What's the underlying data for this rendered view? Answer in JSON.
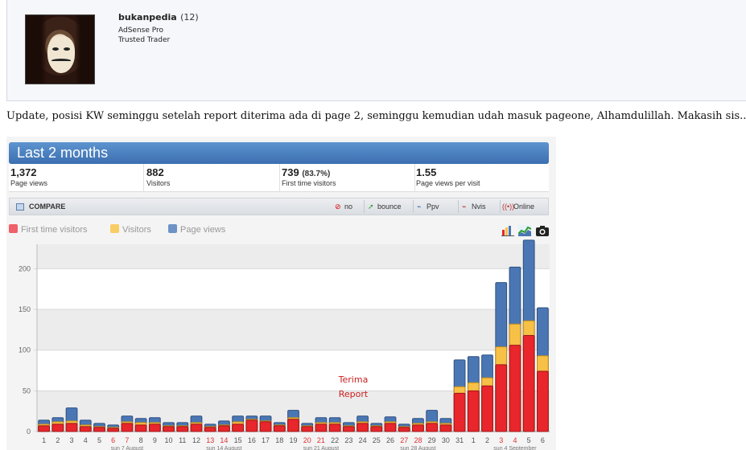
{
  "user": {
    "name": "bukanpedia",
    "post_count": "(12)",
    "title_1": "AdSense Pro",
    "title_2": "Trusted Trader"
  },
  "post": {
    "text": "Update, posisi KW seminggu setelah report diterima ada di page 2, seminggu kemudian udah masuk pageone, Alhamdulillah. Makasih sis.."
  },
  "stats": {
    "title": "Last 2 months",
    "summary": [
      {
        "value": "1,372",
        "pct": "",
        "label": "Page views"
      },
      {
        "value": "882",
        "pct": "",
        "label": "Visitors"
      },
      {
        "value": "739",
        "pct": "(83.7%)",
        "label": "First time visitors"
      },
      {
        "value": "1.55",
        "pct": "",
        "label": "Page views per visit"
      }
    ],
    "toolbar": {
      "compare": "COMPARE",
      "buttons": [
        "no",
        "bounce",
        "Ppv",
        "Nvis",
        "Online"
      ]
    },
    "legend": [
      "First time visitors",
      "Visitors",
      "Page views"
    ],
    "icons": [
      "bar-chart-icon",
      "line-chart-icon",
      "camera-icon"
    ],
    "annotation": [
      "Terima",
      "Report"
    ]
  },
  "colors": {
    "first_time": "#e8262b",
    "visitors": "#f7c046",
    "page_views": "#4a77b4",
    "title_bar": "#4a80c0",
    "weekend_label": "#e03030"
  },
  "chart_data": {
    "type": "bar",
    "ylim": [
      0,
      230
    ],
    "yticks": [
      0,
      50,
      100,
      150,
      200
    ],
    "categories": [
      "1",
      "2",
      "3",
      "4",
      "5",
      "6",
      "7",
      "8",
      "9",
      "10",
      "11",
      "12",
      "13",
      "14",
      "15",
      "16",
      "17",
      "18",
      "19",
      "20",
      "21",
      "22",
      "23",
      "24",
      "25",
      "26",
      "27",
      "28",
      "29",
      "30",
      "31",
      "1",
      "2",
      "3",
      "4",
      "5",
      "6"
    ],
    "weekend_days": [
      "6",
      "7",
      "13",
      "14",
      "20",
      "21",
      "27",
      "28",
      "3",
      "4"
    ],
    "week_labels": [
      "sun 7 August",
      "sun 14 August",
      "sun 21 August",
      "sun 28 August",
      "sun 4 September"
    ],
    "series": [
      {
        "name": "Page views",
        "values": [
          14,
          17,
          29,
          14,
          10,
          8,
          19,
          16,
          17,
          11,
          11,
          19,
          9,
          13,
          19,
          19,
          19,
          11,
          26,
          10,
          17,
          17,
          11,
          19,
          10,
          18,
          9,
          16,
          26,
          16,
          88,
          92,
          94,
          183,
          202,
          235,
          152
        ]
      },
      {
        "name": "Visitors",
        "values": [
          9,
          12,
          13,
          8,
          6,
          5,
          12,
          11,
          11,
          7,
          7,
          11,
          6,
          8,
          12,
          15,
          13,
          8,
          17,
          7,
          11,
          11,
          7,
          12,
          7,
          12,
          6,
          10,
          12,
          10,
          55,
          60,
          66,
          104,
          132,
          136,
          93
        ]
      },
      {
        "name": "First time visitors",
        "values": [
          7,
          9,
          10,
          6,
          5,
          4,
          10,
          8,
          9,
          6,
          6,
          9,
          5,
          7,
          9,
          14,
          12,
          7,
          15,
          6,
          9,
          9,
          6,
          10,
          6,
          10,
          5,
          8,
          10,
          8,
          47,
          50,
          56,
          82,
          106,
          118,
          74
        ]
      }
    ]
  }
}
